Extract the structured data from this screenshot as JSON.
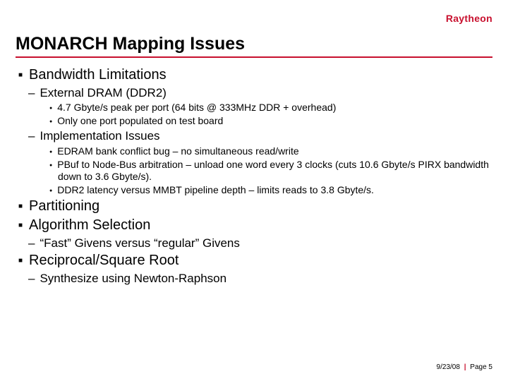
{
  "logo": "Raytheon",
  "title": "MONARCH Mapping Issues",
  "sections": {
    "s0": {
      "label": "Bandwidth Limitations"
    },
    "s0_1": {
      "label": "External DRAM (DDR2)"
    },
    "s0_1_a": "4.7 Gbyte/s peak per port (64 bits @ 333MHz DDR + overhead)",
    "s0_1_b": "Only one port populated on test board",
    "s0_2": {
      "label": "Implementation Issues"
    },
    "s0_2_a": "EDRAM bank conflict bug – no simultaneous read/write",
    "s0_2_b": "PBuf to Node-Bus arbitration – unload one word every 3 clocks (cuts 10.6 Gbyte/s PIRX bandwidth down to 3.6 Gbyte/s).",
    "s0_2_c": "DDR2 latency versus MMBT pipeline depth – limits reads to 3.8 Gbyte/s.",
    "s1": {
      "label": "Partitioning"
    },
    "s2": {
      "label": "Algorithm Selection"
    },
    "s2_1": {
      "label": "“Fast” Givens versus “regular” Givens"
    },
    "s3": {
      "label": "Reciprocal/Square Root"
    },
    "s3_1": {
      "label": "Synthesize using Newton-Raphson"
    }
  },
  "footer": {
    "date": "9/23/08",
    "page": "Page 5"
  }
}
